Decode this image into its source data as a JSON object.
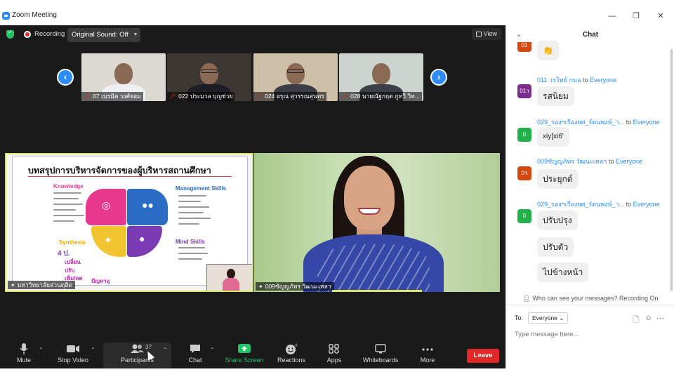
{
  "window": {
    "title": "Zoom Meeting",
    "controls": [
      "—",
      "❐",
      "✕"
    ]
  },
  "topbar": {
    "recording_label": "Recording",
    "sound_button": "Original Sound: Off",
    "view_label": "View"
  },
  "thumbnails": [
    {
      "name": "07 เนรมิต วงศ์จอม",
      "bg": "#dcd9d2",
      "body": "#eef0f2"
    },
    {
      "name": "022 ประมวล บุญช่วย",
      "bg": "#3d3734",
      "body": "#1d1d25"
    },
    {
      "name": "024 อรุณ สุวรรณสุนทร",
      "bg": "#cdbfa8",
      "body": "#3a3d44"
    },
    {
      "name": "028 นายณัฐกฤต ภูทวี วิท...",
      "bg": "#cdd4d0",
      "body": "#3b3f48"
    }
  ],
  "slide": {
    "title": "บทสรุปการบริหารจัดการของผู้บริหารสถานศึกษา",
    "labels": {
      "knowledge": "Knowledge",
      "management": "Management Skills",
      "synthesis": "Synthesis",
      "mind": "Mind Skills",
      "four": "4 ป.",
      "h1": "เปลี่ยน",
      "h2": "ปรับ",
      "h3": "เพิ่ม/ลด",
      "h4": "ปัญหาอุ"
    },
    "colors": {
      "pink": "#e8398e",
      "blue": "#2b6cc4",
      "yellow": "#f2c530",
      "purple": "#7b3bb3"
    }
  },
  "tiles": {
    "left_name": "มหาวิทยาลัยสวนดุสิต",
    "right_name": "009ชัญญภัทร วัฒนะเหลา"
  },
  "toolbar": {
    "mute": "Mute",
    "stop_video": "Stop Video",
    "participants": "Participants",
    "participants_count": "37",
    "chat": "Chat",
    "share_screen": "Share Screen",
    "reactions": "Reactions",
    "apps": "Apps",
    "whiteboards": "Whiteboards",
    "more": "More",
    "leave": "Leave"
  },
  "chat": {
    "title": "Chat",
    "messages": [
      {
        "avatar": "01",
        "avatar_color": "#d24a12",
        "sender": "",
        "to": "",
        "recipient": "",
        "bubbles": [
          "👏"
        ]
      },
      {
        "avatar": "01ว",
        "avatar_color": "#7b2d8e",
        "sender": "011 วรวิทย์ กมล",
        "to": "to",
        "recipient": "Everyone",
        "bubbles": [
          "รสนิยม"
        ]
      },
      {
        "avatar": "0",
        "avatar_color": "#23b04a",
        "sender": "029_รองฯเรืองยศ_รัตนพงษ์_า...",
        "to": "to",
        "recipient": "Everyone",
        "bubbles": [
          "xiy[xi6'"
        ]
      },
      {
        "avatar": "0ว",
        "avatar_color": "#d24a12",
        "sender": "009ชัญญภัทร วัฒนะเหลา",
        "to": "to",
        "recipient": "Everyone",
        "bubbles": [
          "ประยุกต์"
        ]
      },
      {
        "avatar": "0",
        "avatar_color": "#23b04a",
        "sender": "029_รองฯเรืองยศ_รัตนพงษ์_า...",
        "to": "to",
        "recipient": "Everyone",
        "bubbles": [
          "ปรับปรุง",
          "ปรับตัว",
          "ไปข้างหน้า"
        ]
      }
    ],
    "visibility_note": "Who can see your messages? Recording On",
    "to_label": "To:",
    "to_value": "Everyone",
    "input_placeholder": "Type message here..."
  }
}
